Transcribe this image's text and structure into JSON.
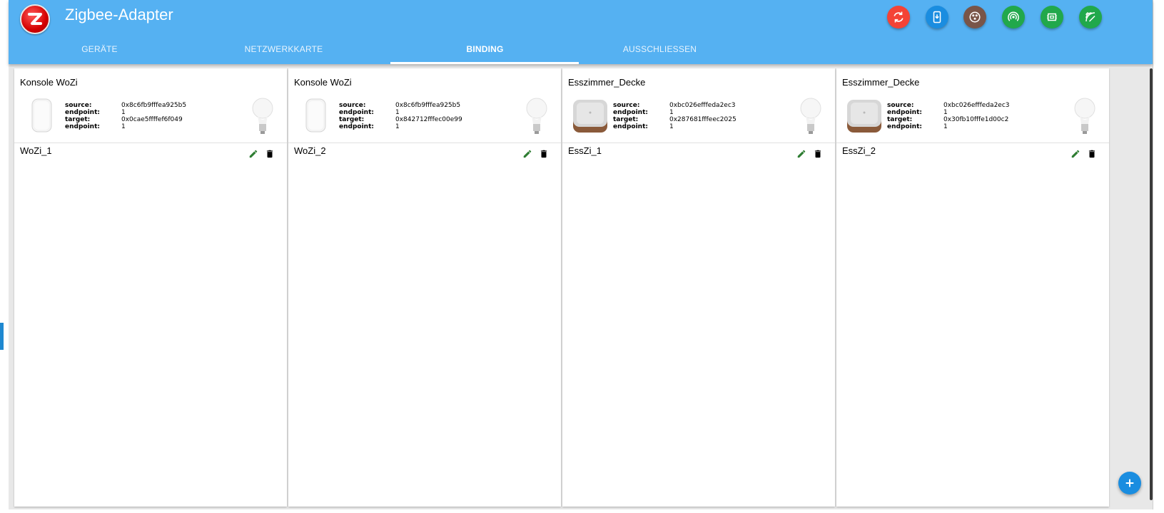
{
  "app": {
    "title": "Zigbee-Adapter",
    "accent_color": "#55b1f2"
  },
  "toolbar": {
    "buttons": [
      {
        "name": "refresh-icon",
        "color": "#f44336"
      },
      {
        "name": "device-download-icon",
        "color": "#1a8de0"
      },
      {
        "name": "group-icon",
        "color": "#795548"
      },
      {
        "name": "pairing-signal-icon",
        "color": "#21a84b"
      },
      {
        "name": "memory-chip-icon",
        "color": "#21a84b"
      },
      {
        "name": "signal-off-icon",
        "color": "#21a84b"
      }
    ]
  },
  "tabs": [
    {
      "label": "GERÄTE",
      "active": false
    },
    {
      "label": "NETZWERKKARTE",
      "active": false
    },
    {
      "label": "BINDING",
      "active": true
    },
    {
      "label": "AUSSCHLIESSEN",
      "active": false
    }
  ],
  "bindings": [
    {
      "device_name": "Konsole WoZi",
      "device_icon": "remote-icon",
      "source_label": "source:",
      "source": "0x8c6fb9fffea925b5",
      "source_ep_label": "endpoint:",
      "source_ep": "1",
      "target_label": "target:",
      "target": "0x0cae5ffffef6f049",
      "target_ep_label": "endpoint:",
      "target_ep": "1",
      "target_icon": "bulb-icon",
      "binding_name": "WoZi_1"
    },
    {
      "device_name": "Konsole WoZi",
      "device_icon": "remote-icon",
      "source_label": "source:",
      "source": "0x8c6fb9fffea925b5",
      "source_ep_label": "endpoint:",
      "source_ep": "1",
      "target_label": "target:",
      "target": "0x842712fffec00e99",
      "target_ep_label": "endpoint:",
      "target_ep": "1",
      "target_icon": "bulb-icon",
      "binding_name": "WoZi_2"
    },
    {
      "device_name": "Esszimmer_Decke",
      "device_icon": "dimmer-icon",
      "source_label": "source:",
      "source": "0xbc026efffeda2ec3",
      "source_ep_label": "endpoint:",
      "source_ep": "1",
      "target_label": "target:",
      "target": "0x287681fffeec2025",
      "target_ep_label": "endpoint:",
      "target_ep": "1",
      "target_icon": "bulb-icon",
      "binding_name": "EssZi_1"
    },
    {
      "device_name": "Esszimmer_Decke",
      "device_icon": "dimmer-icon",
      "source_label": "source:",
      "source": "0xbc026efffeda2ec3",
      "source_ep_label": "endpoint:",
      "source_ep": "1",
      "target_label": "target:",
      "target": "0x30fb10fffe1d00c2",
      "target_ep_label": "endpoint:",
      "target_ep": "1",
      "target_icon": "bulb-icon",
      "binding_name": "EssZi_2"
    }
  ],
  "actions": {
    "edit_icon": "pencil-icon",
    "delete_icon": "trash-icon",
    "edit_color": "#2e7d32",
    "add_icon": "plus-icon"
  }
}
